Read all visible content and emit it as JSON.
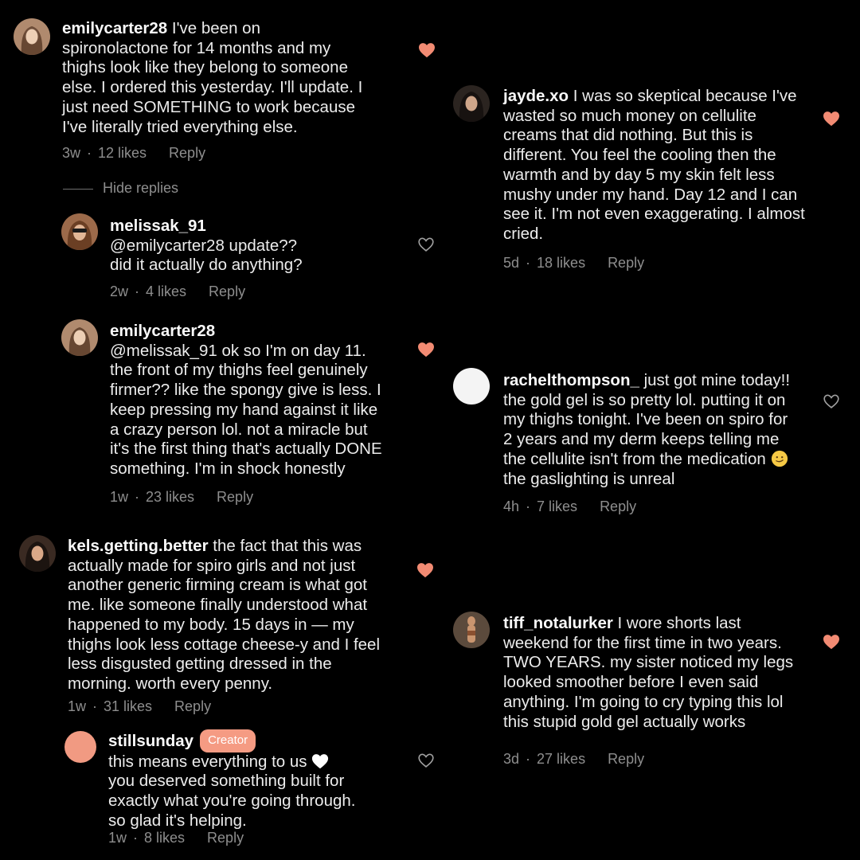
{
  "colors": {
    "accent": "#f28b73",
    "muted": "#8e8e8e",
    "background": "#000000"
  },
  "comments": {
    "emily": {
      "username": "emilycarter28",
      "lines": [
        "I've been on",
        "spironolactone for 14 months and my",
        "thighs look like they belong to someone",
        "else. I ordered this yesterday. I'll update. I",
        "just need SOMETHING to work because",
        "I've literally tried everything else."
      ],
      "time": "3w",
      "likes": "12 likes",
      "reply": "Reply",
      "liked": true
    },
    "hide_replies": "Hide replies",
    "melissa": {
      "username": "melissak_91",
      "lines": [
        "@emilycarter28 update??",
        "did it actually do anything?"
      ],
      "time": "2w",
      "likes": "4 likes",
      "reply": "Reply",
      "liked": false
    },
    "emily_reply": {
      "username": "emilycarter28",
      "lines": [
        "@melissak_91 ok so I'm on day 11.",
        "the front of my thighs feel genuinely",
        "firmer?? like the spongy give is less. I",
        "keep pressing my hand against it like",
        "a crazy person lol. not a miracle but",
        "it's the first thing that's actually DONE",
        "something. I'm in shock honestly"
      ],
      "time": "1w",
      "likes": "23 likes",
      "reply": "Reply",
      "liked": true
    },
    "kels": {
      "username": "kels.getting.better",
      "lines": [
        "the fact that this was",
        "actually made for spiro girls and not just",
        "another generic firming cream is what got",
        "me. like someone finally understood what",
        "happened to my body. 15 days in — my",
        "thighs look less cottage cheese-y and I feel",
        "less disgusted getting dressed in the",
        "morning. worth every penny."
      ],
      "time": "1w",
      "likes": "31 likes",
      "reply": "Reply",
      "liked": true
    },
    "stillsunday": {
      "username": "stillsunday",
      "badge": "Creator",
      "lines": [
        "this means everything to us",
        "you deserved something built for",
        "exactly what you're going through.",
        "so glad it's helping."
      ],
      "emoji": "white-heart",
      "time": "1w",
      "likes": "8 likes",
      "reply": "Reply",
      "liked": false
    },
    "jayde": {
      "username": "jayde.xo",
      "lines": [
        "I was so skeptical because I've",
        "wasted so much money on cellulite",
        "creams that did nothing. But this is",
        "different. You feel the cooling then the",
        "warmth and by day 5 my skin felt less",
        "mushy under my hand. Day 12 and I can",
        "see it. I'm not even exaggerating. I almost",
        "cried."
      ],
      "time": "5d",
      "likes": "18 likes",
      "reply": "Reply",
      "liked": true
    },
    "rachel": {
      "username": "rachelthompson_",
      "lines": [
        "just got mine today!!",
        "the gold gel is so pretty lol. putting it on",
        "my thighs tonight. I've been on spiro for",
        "2 years and my derm keeps telling me",
        "the cellulite isn't from the medication",
        "the gaslighting is unreal"
      ],
      "emoji": "smirk-face",
      "time": "4h",
      "likes": "7 likes",
      "reply": "Reply",
      "liked": false
    },
    "tiff": {
      "username": "tiff_notalurker",
      "lines": [
        "I wore shorts last",
        "weekend for the first time in two years.",
        "TWO YEARS. my sister noticed my legs",
        "looked smoother before I even said",
        "anything. I'm going to cry typing this lol",
        "this stupid gold gel actually works"
      ],
      "time": "3d",
      "likes": "27 likes",
      "reply": "Reply",
      "liked": true
    }
  }
}
